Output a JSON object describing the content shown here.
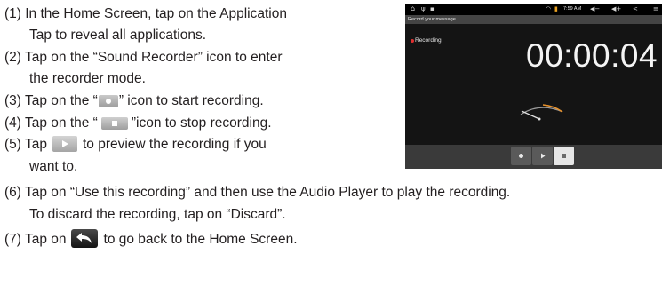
{
  "instructions": {
    "step1": {
      "line1": "(1) In the Home Screen, tap on the Application",
      "line2": "Tap to reveal all applications."
    },
    "step2": {
      "line1": "(2) Tap on the “Sound Recorder” icon to enter",
      "line2": "the recorder mode."
    },
    "step3": {
      "before": "(3) Tap on the “",
      "after": "” icon to start recording."
    },
    "step4": {
      "before": "(4) Tap on the “",
      "after": "”icon to stop recording."
    },
    "step5": {
      "before": "(5) Tap",
      "after": "to preview the recording if you",
      "line2": "want to."
    },
    "step6": {
      "line1": "(6) Tap on “Use this recording” and then use the Audio Player to play the recording.",
      "line2": "To discard the recording, tap on “Discard”."
    },
    "step7": {
      "before": "(7) Tap on",
      "after": "to go back to the Home Screen."
    }
  },
  "icons": {
    "record": "record-icon",
    "stop": "stop-icon",
    "play": "play-icon",
    "back": "back-arrow-icon"
  },
  "device_screenshot": {
    "status_time": "7:59 AM",
    "title_bar": "Record your message",
    "recording_label": "Recording",
    "timer": "00:00:04",
    "colors": {
      "recording_dot": "#e03030",
      "vu_needle_arc": "#e8912a"
    }
  }
}
